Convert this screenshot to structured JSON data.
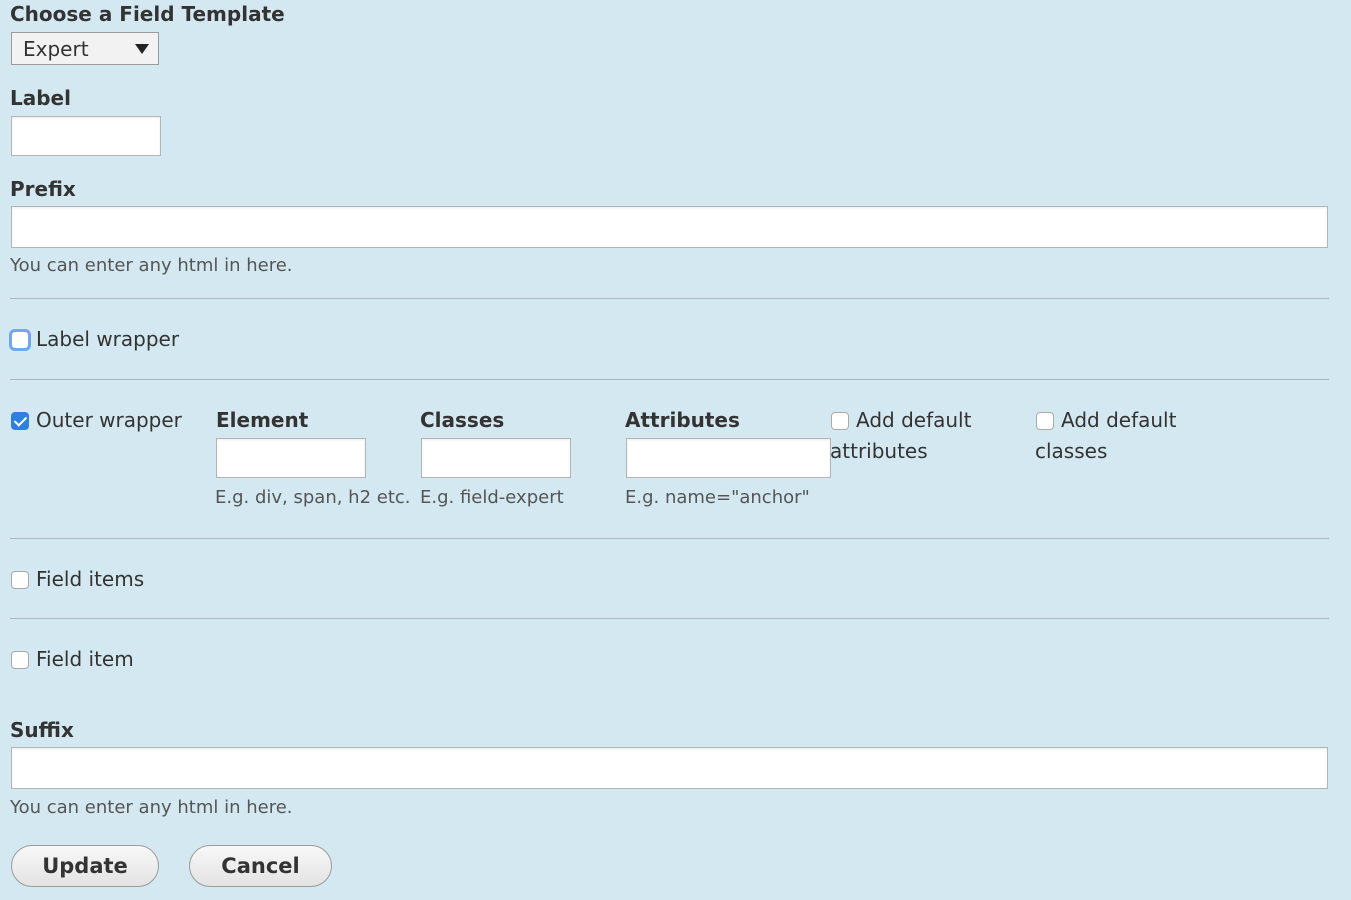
{
  "template": {
    "label": "Choose a Field Template",
    "selected": "Expert"
  },
  "label_field": {
    "label": "Label",
    "value": ""
  },
  "prefix": {
    "label": "Prefix",
    "value": "",
    "help": "You can enter any html in here."
  },
  "label_wrapper": {
    "label": "Label wrapper",
    "checked": false
  },
  "outer_wrapper": {
    "label": "Outer wrapper",
    "checked": true,
    "element": {
      "label": "Element",
      "value": "",
      "help": "E.g. div, span, h2 etc."
    },
    "classes": {
      "label": "Classes",
      "value": "",
      "help": "E.g. field-expert"
    },
    "attributes": {
      "label": "Attributes",
      "value": "",
      "help": "E.g. name=\"anchor\""
    },
    "add_default_attributes": {
      "label_line1": "Add default",
      "label_line2": "attributes",
      "checked": false
    },
    "add_default_classes": {
      "label_line1": "Add default",
      "label_line2": "classes",
      "checked": false
    }
  },
  "field_items": {
    "label": "Field items",
    "checked": false
  },
  "field_item": {
    "label": "Field item",
    "checked": false
  },
  "suffix": {
    "label": "Suffix",
    "value": "",
    "help": "You can enter any html in here."
  },
  "buttons": {
    "update": "Update",
    "cancel": "Cancel"
  },
  "colors": {
    "background": "#d4e8f1",
    "checkbox_checked": "#2f7fe0"
  }
}
